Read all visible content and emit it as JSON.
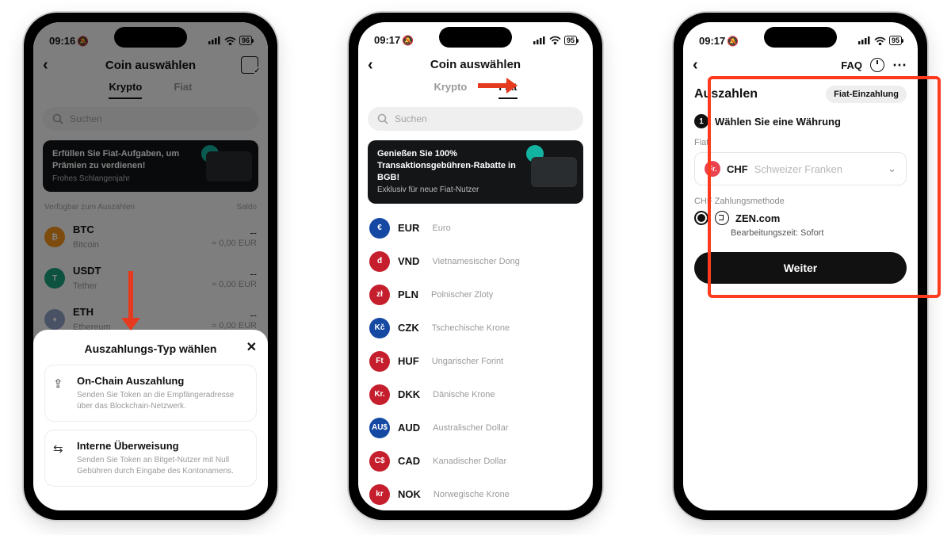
{
  "screen1": {
    "time": "09:16",
    "battery": "96",
    "title": "Coin auswählen",
    "tabs": {
      "krypto": "Krypto",
      "fiat": "Fiat"
    },
    "search_placeholder": "Suchen",
    "promo": {
      "title": "Erfüllen Sie Fiat-Aufgaben, um Prämien zu verdienen!",
      "sub": "Frohes Schlangenjahr"
    },
    "section_left": "Verfügbar zum Auszahlen",
    "section_right": "Saldo",
    "coins": [
      {
        "sym": "BTC",
        "name": "Bitcoin",
        "dash": "--",
        "fiat": "≈ 0,00 EUR"
      },
      {
        "sym": "USDT",
        "name": "Tether",
        "dash": "--",
        "fiat": "≈ 0,00 EUR"
      },
      {
        "sym": "ETH",
        "name": "Ethereum",
        "dash": "--",
        "fiat": "≈ 0,00 EUR"
      }
    ],
    "sheet": {
      "title": "Auszahlungs-Typ wählen",
      "opt1_t": "On-Chain Auszahlung",
      "opt1_d": "Senden Sie Token an die Empfängeradresse über das Blockchain-Netzwerk.",
      "opt2_t": "Interne Überweisung",
      "opt2_d": "Senden Sie Token an Bitget-Nutzer mit Null Gebühren durch Eingabe des Kontonamens."
    }
  },
  "screen2": {
    "time": "09:17",
    "battery": "95",
    "title": "Coin auswählen",
    "tabs": {
      "krypto": "Krypto",
      "fiat": "Fiat"
    },
    "search_placeholder": "Suchen",
    "promo": {
      "title": "Genießen Sie 100% Transaktionsgebühren-Rabatte in BGB!",
      "sub": "Exklusiv für neue Fiat-Nutzer"
    },
    "coins": [
      {
        "sym": "EUR",
        "name": "Euro",
        "bg": "#1548a3",
        "txt": "€"
      },
      {
        "sym": "VND",
        "name": "Vietnamesischer Dong",
        "bg": "#c51f2d",
        "txt": "đ"
      },
      {
        "sym": "PLN",
        "name": "Polnischer Zloty",
        "bg": "#c51f2d",
        "txt": "zł"
      },
      {
        "sym": "CZK",
        "name": "Tschechische Krone",
        "bg": "#1548a3",
        "txt": "Kč"
      },
      {
        "sym": "HUF",
        "name": "Ungarischer Forint",
        "bg": "#c51f2d",
        "txt": "Ft"
      },
      {
        "sym": "DKK",
        "name": "Dänische Krone",
        "bg": "#c51f2d",
        "txt": "Kr."
      },
      {
        "sym": "AUD",
        "name": "Australischer Dollar",
        "bg": "#1548a3",
        "txt": "AU$"
      },
      {
        "sym": "CAD",
        "name": "Kanadischer Dollar",
        "bg": "#c51f2d",
        "txt": "C$"
      },
      {
        "sym": "NOK",
        "name": "Norwegische Krone",
        "bg": "#c51f2d",
        "txt": "kr"
      }
    ]
  },
  "screen3": {
    "time": "09:17",
    "battery": "95",
    "faq": "FAQ",
    "heading": "Auszahlen",
    "pill": "Fiat-Einzahlung",
    "step_title": "Wählen Sie eine Währung",
    "fiat_label": "Fiat",
    "currency_code": "CHF",
    "currency_name": "Schweizer Franken",
    "method_label": "CHF Zahlungsmethode",
    "method_name": "ZEN.com",
    "method_note": "Bearbeitungszeit: Sofort",
    "cta": "Weiter"
  }
}
